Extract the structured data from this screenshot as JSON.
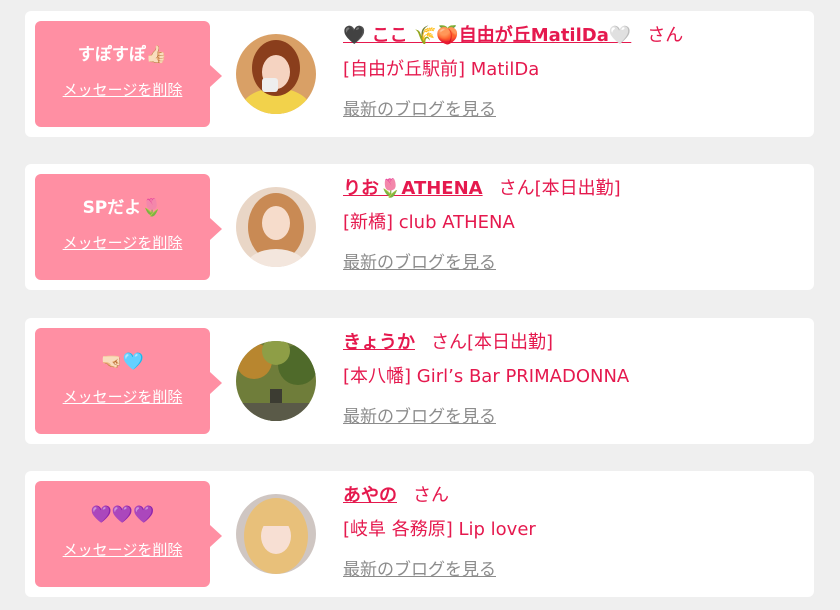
{
  "delete_label": "メッセージを削除",
  "blog_label": "最新のブログを見る",
  "honorific": "さん",
  "colors": {
    "bubble": "#ff8fa3",
    "accent": "#e5194e",
    "link_gray": "#8c8c8c",
    "background": "#efefef"
  },
  "items": [
    {
      "message": "すぽすぽ👍🏻",
      "name": "🖤 ここ 🌾🍑自由が丘MatilDa🤍",
      "status": "",
      "shop": "[自由が丘駅前] MatilDa",
      "avatar_icon": "avatar-icon"
    },
    {
      "message": "SPだよ🌷",
      "name": "りお🌷ATHENA",
      "status": "[本日出勤]",
      "shop": "[新橋] club ATHENA",
      "avatar_icon": "avatar-icon"
    },
    {
      "message": "🤜🏻🩵",
      "name": "きょうか",
      "status": "[本日出勤]",
      "shop": "[本八幡] Girl’s Bar PRIMADONNA",
      "avatar_icon": "avatar-icon"
    },
    {
      "message": "💜💜💜",
      "name": "あやの",
      "status": "",
      "shop": "[岐阜 各務原] Lip lover",
      "avatar_icon": "avatar-icon"
    }
  ]
}
